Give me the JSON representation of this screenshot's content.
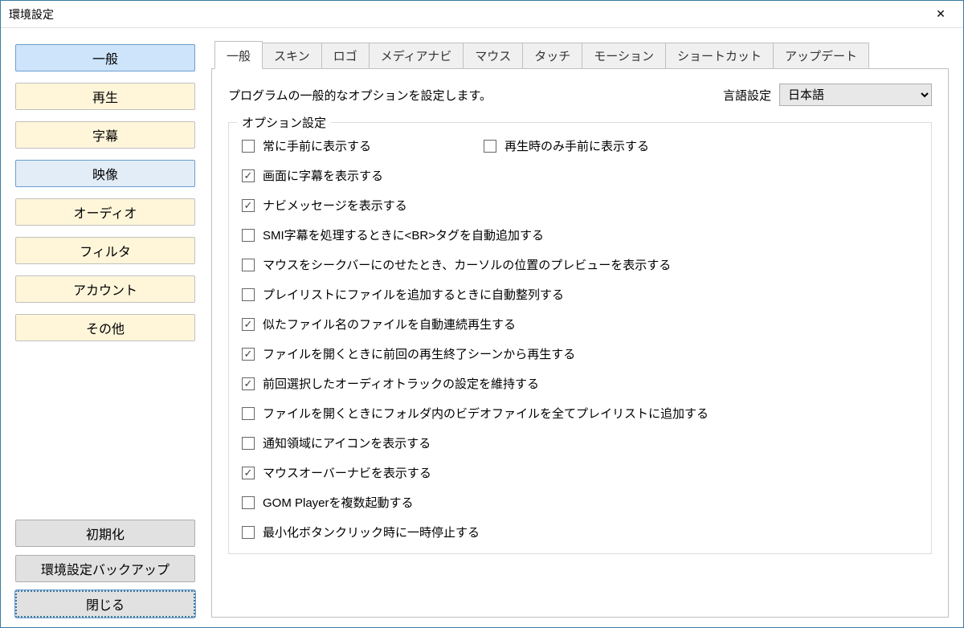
{
  "window": {
    "title": "環境設定"
  },
  "sidebar": {
    "items": [
      {
        "label": "一般",
        "state": "selected"
      },
      {
        "label": "再生",
        "state": "normal"
      },
      {
        "label": "字幕",
        "state": "normal"
      },
      {
        "label": "映像",
        "state": "hover"
      },
      {
        "label": "オーディオ",
        "state": "normal"
      },
      {
        "label": "フィルタ",
        "state": "normal"
      },
      {
        "label": "アカウント",
        "state": "normal"
      },
      {
        "label": "その他",
        "state": "normal"
      }
    ],
    "buttons": {
      "reset": "初期化",
      "backup": "環境設定バックアップ",
      "close": "閉じる"
    }
  },
  "tabs": [
    {
      "label": "一般",
      "active": true
    },
    {
      "label": "スキン",
      "active": false
    },
    {
      "label": "ロゴ",
      "active": false
    },
    {
      "label": "メディアナビ",
      "active": false
    },
    {
      "label": "マウス",
      "active": false
    },
    {
      "label": "タッチ",
      "active": false
    },
    {
      "label": "モーション",
      "active": false
    },
    {
      "label": "ショートカット",
      "active": false
    },
    {
      "label": "アップデート",
      "active": false
    }
  ],
  "panel": {
    "description": "プログラムの一般的なオプションを設定します。",
    "language_label": "言語設定",
    "language_value": "日本語",
    "group_title": "オプション設定",
    "options": [
      {
        "label": "常に手前に表示する",
        "checked": false,
        "pair": {
          "label": "再生時のみ手前に表示する",
          "checked": false
        }
      },
      {
        "label": "画面に字幕を表示する",
        "checked": true
      },
      {
        "label": "ナビメッセージを表示する",
        "checked": true
      },
      {
        "label": "SMI字幕を処理するときに<BR>タグを自動追加する",
        "checked": false
      },
      {
        "label": "マウスをシークバーにのせたとき、カーソルの位置のプレビューを表示する",
        "checked": false
      },
      {
        "label": "プレイリストにファイルを追加するときに自動整列する",
        "checked": false
      },
      {
        "label": "似たファイル名のファイルを自動連続再生する",
        "checked": true
      },
      {
        "label": "ファイルを開くときに前回の再生終了シーンから再生する",
        "checked": true
      },
      {
        "label": "前回選択したオーディオトラックの設定を維持する",
        "checked": true
      },
      {
        "label": "ファイルを開くときにフォルダ内のビデオファイルを全てプレイリストに追加する",
        "checked": false
      },
      {
        "label": "通知領域にアイコンを表示する",
        "checked": false
      },
      {
        "label": "マウスオーバーナビを表示する",
        "checked": true
      },
      {
        "label": "GOM Playerを複数起動する",
        "checked": false
      },
      {
        "label": "最小化ボタンクリック時に一時停止する",
        "checked": false
      }
    ]
  }
}
